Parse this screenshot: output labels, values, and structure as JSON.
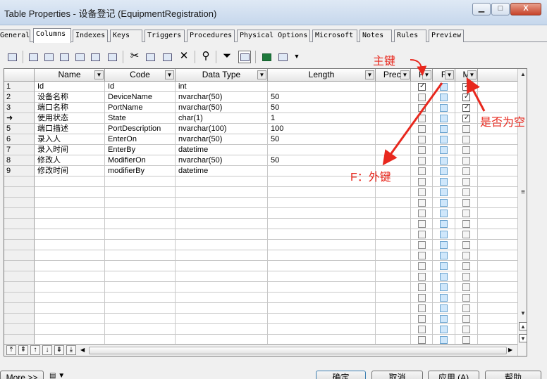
{
  "window": {
    "title": "Table Properties - 设备登记 (EquipmentRegistration)",
    "minimize_label": "▁",
    "maximize_label": "□",
    "close_label": "X"
  },
  "tabs": [
    "General",
    "Columns",
    "Indexes",
    "Keys",
    "Triggers",
    "Procedures",
    "Physical Options",
    "Microsoft",
    "Notes",
    "Rules",
    "Preview"
  ],
  "active_tab": "Columns",
  "grid": {
    "headers": {
      "name": "Name",
      "code": "Code",
      "data_type": "Data Type",
      "length": "Length",
      "precision": "Preci",
      "p": "P",
      "f": "F",
      "m": "M"
    },
    "rows": [
      {
        "num": "1",
        "name": "Id",
        "code": "Id",
        "type": "int",
        "length": "",
        "p": true,
        "f": false,
        "m": true
      },
      {
        "num": "2",
        "name": "设备名称",
        "code": "DeviceName",
        "type": "nvarchar(50)",
        "length": "50",
        "p": false,
        "f": false,
        "m": true
      },
      {
        "num": "3",
        "name": "端口名称",
        "code": "PortName",
        "type": "nvarchar(50)",
        "length": "50",
        "p": false,
        "f": false,
        "m": true
      },
      {
        "num": "➜",
        "name": "使用状态",
        "code": "State",
        "type": "char(1)",
        "length": "1",
        "p": false,
        "f": false,
        "m": true
      },
      {
        "num": "5",
        "name": "端口描述",
        "code": "PortDescription",
        "type": "nvarchar(100)",
        "length": "100",
        "p": false,
        "f": false,
        "m": false
      },
      {
        "num": "6",
        "name": "录入人",
        "code": "EnterOn",
        "type": "nvarchar(50)",
        "length": "50",
        "p": false,
        "f": false,
        "m": false
      },
      {
        "num": "7",
        "name": "录入时间",
        "code": "EnterBy",
        "type": "datetime",
        "length": "",
        "p": false,
        "f": false,
        "m": false
      },
      {
        "num": "8",
        "name": "修改人",
        "code": "ModifierOn",
        "type": "nvarchar(50)",
        "length": "50",
        "p": false,
        "f": false,
        "m": false
      },
      {
        "num": "9",
        "name": "修改时间",
        "code": "modifierBy",
        "type": "datetime",
        "length": "",
        "p": false,
        "f": false,
        "m": false
      }
    ],
    "empty_rows": 16
  },
  "annotations": {
    "primary_key": "主键",
    "foreign_key": "F：外键",
    "nullable": "是否为空"
  },
  "buttons": {
    "more": "More >>",
    "ok": "确定",
    "cancel": "取消",
    "apply": "应用 (A)",
    "help": "帮助"
  },
  "colors": {
    "annotation": "#e8281e",
    "fk_checkbox": "#cfe7fb"
  }
}
